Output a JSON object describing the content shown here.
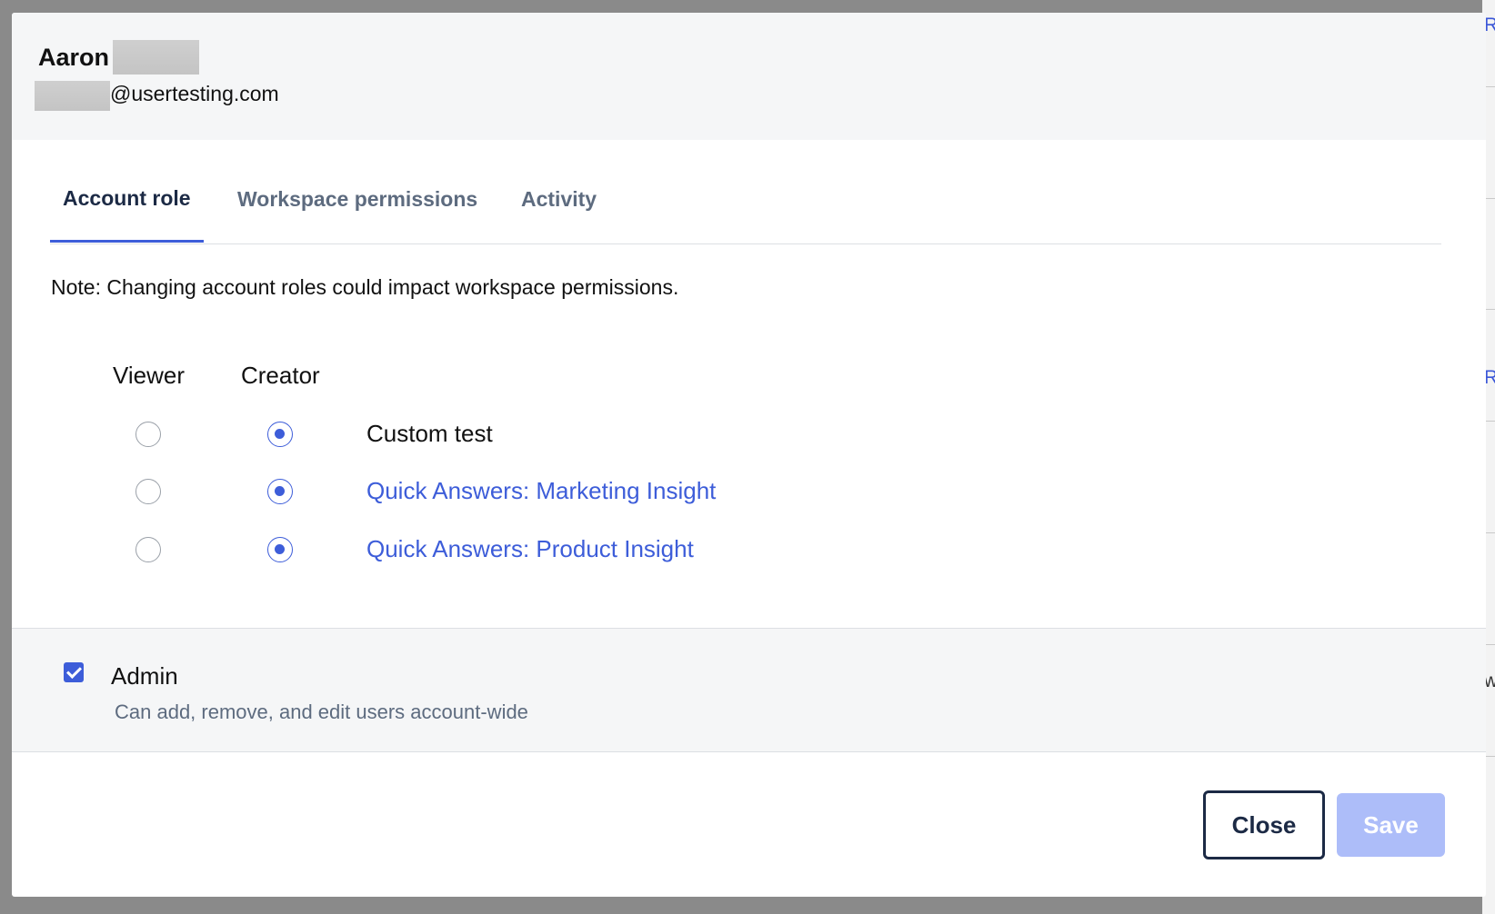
{
  "user": {
    "first_name": "Aaron",
    "email_suffix": "@usertesting.com"
  },
  "tabs": [
    {
      "label": "Account role",
      "active": true
    },
    {
      "label": "Workspace permissions",
      "active": false
    },
    {
      "label": "Activity",
      "active": false
    }
  ],
  "note": "Note: Changing account roles could impact workspace permissions.",
  "role_columns": {
    "viewer": "Viewer",
    "creator": "Creator"
  },
  "workspaces": [
    {
      "name": "Custom test",
      "role": "Creator",
      "is_link": false
    },
    {
      "name": "Quick Answers: Marketing Insight",
      "role": "Creator",
      "is_link": true
    },
    {
      "name": "Quick Answers: Product Insight",
      "role": "Creator",
      "is_link": true
    }
  ],
  "admin": {
    "label": "Admin",
    "checked": true,
    "description": "Can add, remove, and edit users account-wide"
  },
  "footer": {
    "close_label": "Close",
    "save_label": "Save",
    "save_disabled": true
  },
  "background_partial_glyphs": [
    "R",
    "R",
    "w"
  ],
  "colors": {
    "accent": "#3d5dd9",
    "dark": "#1c2a45",
    "muted": "#5d6b7f",
    "save_disabled": "#adbdf9"
  }
}
